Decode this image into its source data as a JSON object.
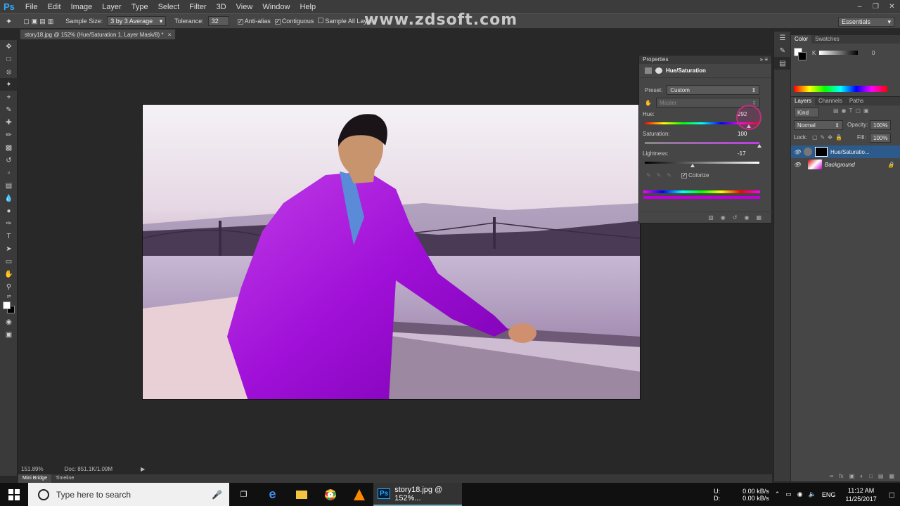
{
  "app": {
    "logo": "Ps",
    "title": "story18.jpg @ 152% (Hue/Saturation 1, Layer Mask/8) *",
    "watermark": "www.zdsoft.com"
  },
  "menu": [
    "File",
    "Edit",
    "Image",
    "Layer",
    "Type",
    "Select",
    "Filter",
    "3D",
    "View",
    "Window",
    "Help"
  ],
  "options_bar": {
    "sample_size_label": "Sample Size:",
    "sample_size_value": "3 by 3 Average",
    "tolerance_label": "Tolerance:",
    "tolerance_value": "32",
    "anti_alias": "Anti-alias",
    "contiguous": "Contiguous",
    "sample_all_layers": "Sample All Layers",
    "workspace": "Essentials"
  },
  "properties": {
    "title": "Properties",
    "adjustment": "Hue/Saturation",
    "preset_label": "Preset:",
    "preset_value": "Custom",
    "channel": "Master",
    "hue_label": "Hue:",
    "hue_value": "292",
    "hue_pos": 0.91,
    "saturation_label": "Saturation:",
    "saturation_value": "100",
    "sat_pos": 1.0,
    "lightness_label": "Lightness:",
    "lightness_value": "-17",
    "light_pos": 0.42,
    "colorize_label": "Colorize"
  },
  "color_panel": {
    "tabs": [
      "Color",
      "Swatches"
    ],
    "k_label": "K",
    "k_value": "0"
  },
  "layers_panel": {
    "tabs": [
      "Layers",
      "Channels",
      "Paths"
    ],
    "kind": "Kind",
    "blend_mode": "Normal",
    "opacity_label": "Opacity:",
    "opacity_value": "100%",
    "lock_label": "Lock:",
    "fill_label": "Fill:",
    "fill_value": "100%",
    "layers": [
      {
        "name": "Hue/Saturatio..."
      },
      {
        "name": "Background"
      }
    ]
  },
  "status": {
    "zoom": "151.89%",
    "doc": "Doc: 851.1K/1.09M"
  },
  "bottom_tabs": [
    "Mini Bridge",
    "Timeline"
  ],
  "taskbar": {
    "search_placeholder": "Type here to search",
    "ps_task": "story18.jpg @ 152%...",
    "net_u": "U:",
    "net_d": "D:",
    "net_up": "0.00 kB/s",
    "net_down": "0.00 kB/s",
    "lang": "ENG",
    "time": "11:12 AM",
    "date": "11/25/2017"
  }
}
